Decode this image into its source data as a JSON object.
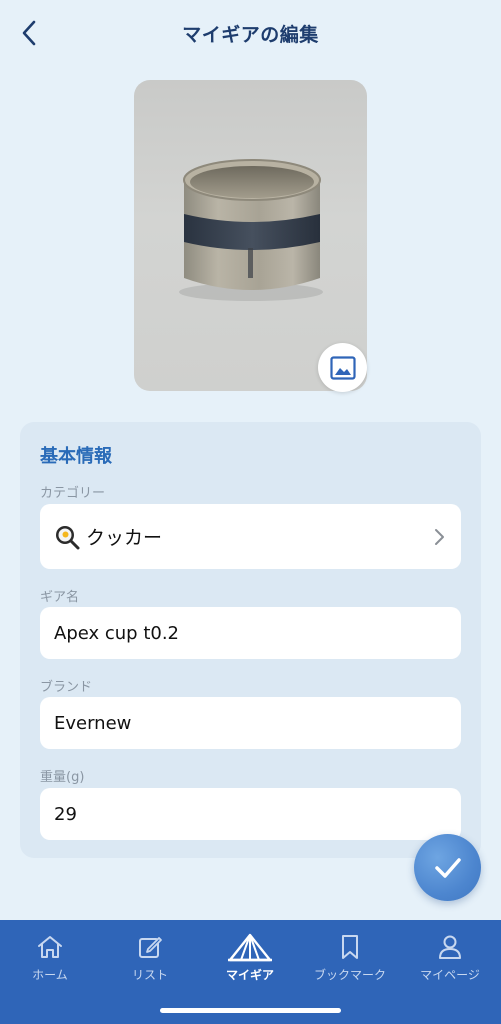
{
  "header": {
    "title": "マイギアの編集",
    "back_icon": "chevron-left-icon"
  },
  "photo": {
    "subject": "titanium cup",
    "change_image_icon": "image-icon"
  },
  "form": {
    "section_title": "基本情報",
    "category": {
      "label": "カテゴリー",
      "value": "クッカー",
      "icon": "frying-pan-icon"
    },
    "gear_name": {
      "label": "ギア名",
      "value": "Apex cup t0.2"
    },
    "brand": {
      "label": "ブランド",
      "value": "Evernew"
    },
    "weight": {
      "label": "重量(g)",
      "value": "29"
    }
  },
  "save_button": {
    "icon": "check-icon"
  },
  "tabbar": {
    "items": [
      {
        "label": "ホーム",
        "icon": "home-icon",
        "active": false
      },
      {
        "label": "リスト",
        "icon": "edit-icon",
        "active": false
      },
      {
        "label": "マイギア",
        "icon": "tent-icon",
        "active": true
      },
      {
        "label": "ブックマーク",
        "icon": "bookmark-icon",
        "active": false
      },
      {
        "label": "マイページ",
        "icon": "person-icon",
        "active": false
      }
    ]
  },
  "colors": {
    "background": "#e6f1f9",
    "accent": "#2f65b8",
    "title": "#1e3d6e",
    "section_title": "#2a6bb8"
  }
}
